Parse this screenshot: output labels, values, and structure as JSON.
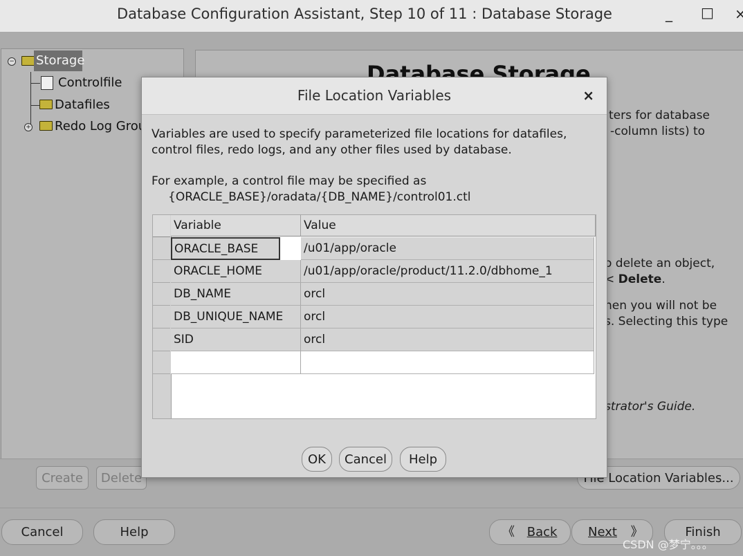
{
  "window": {
    "title": "Database Configuration Assistant, Step 10 of 11 : Database Storage",
    "controls": {
      "minimize": "_",
      "maximize": "□",
      "close": "×"
    }
  },
  "tree": {
    "root": "Storage",
    "children": [
      "Controlfile",
      "Datafiles",
      "Redo Log Grou"
    ]
  },
  "right_panel": {
    "heading": "Database Storage",
    "lines": [
      "ters for database",
      "-column lists) to",
      "o delete an object,",
      "< ",
      "Delete",
      ".",
      "hen you will not be",
      "s. Selecting this type",
      "strator's Guide."
    ]
  },
  "storage_buttons": {
    "create": "Create",
    "delete": "Delete",
    "file_location": "File Location Variables..."
  },
  "wizard_buttons": {
    "cancel": "Cancel",
    "help": "Help",
    "back": "Back",
    "next": "Next",
    "finish": "Finish"
  },
  "dialog": {
    "title": "File Location Variables",
    "close": "×",
    "intro_line1": "Variables are used to specify parameterized file locations for datafiles,",
    "intro_line2": "control files, redo logs, and any other files used by database.",
    "example_line1": "For example, a control file may be specified as",
    "example_line2": "{ORACLE_BASE}/oradata/{DB_NAME}/control01.ctl",
    "table": {
      "headers": [
        "Variable",
        "Value"
      ],
      "rows": [
        [
          "ORACLE_BASE",
          "/u01/app/oracle"
        ],
        [
          "ORACLE_HOME",
          "/u01/app/oracle/product/11.2.0/dbhome_1"
        ],
        [
          "DB_NAME",
          "orcl"
        ],
        [
          "DB_UNIQUE_NAME",
          "orcl"
        ],
        [
          "SID",
          "orcl"
        ],
        [
          "",
          ""
        ]
      ]
    },
    "buttons": {
      "ok": "OK",
      "cancel": "Cancel",
      "help": "Help"
    }
  },
  "watermark": "CSDN @梦宁。。。"
}
